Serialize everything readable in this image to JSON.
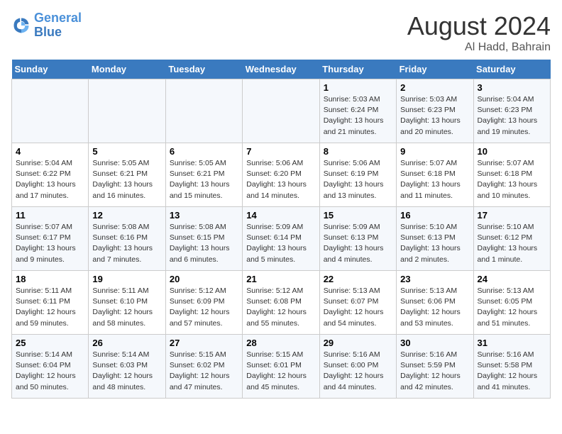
{
  "header": {
    "logo_line1": "General",
    "logo_line2": "Blue",
    "main_title": "August 2024",
    "subtitle": "Al Hadd, Bahrain"
  },
  "weekdays": [
    "Sunday",
    "Monday",
    "Tuesday",
    "Wednesday",
    "Thursday",
    "Friday",
    "Saturday"
  ],
  "weeks": [
    [
      {
        "day": "",
        "info": ""
      },
      {
        "day": "",
        "info": ""
      },
      {
        "day": "",
        "info": ""
      },
      {
        "day": "",
        "info": ""
      },
      {
        "day": "1",
        "info": "Sunrise: 5:03 AM\nSunset: 6:24 PM\nDaylight: 13 hours\nand 21 minutes."
      },
      {
        "day": "2",
        "info": "Sunrise: 5:03 AM\nSunset: 6:23 PM\nDaylight: 13 hours\nand 20 minutes."
      },
      {
        "day": "3",
        "info": "Sunrise: 5:04 AM\nSunset: 6:23 PM\nDaylight: 13 hours\nand 19 minutes."
      }
    ],
    [
      {
        "day": "4",
        "info": "Sunrise: 5:04 AM\nSunset: 6:22 PM\nDaylight: 13 hours\nand 17 minutes."
      },
      {
        "day": "5",
        "info": "Sunrise: 5:05 AM\nSunset: 6:21 PM\nDaylight: 13 hours\nand 16 minutes."
      },
      {
        "day": "6",
        "info": "Sunrise: 5:05 AM\nSunset: 6:21 PM\nDaylight: 13 hours\nand 15 minutes."
      },
      {
        "day": "7",
        "info": "Sunrise: 5:06 AM\nSunset: 6:20 PM\nDaylight: 13 hours\nand 14 minutes."
      },
      {
        "day": "8",
        "info": "Sunrise: 5:06 AM\nSunset: 6:19 PM\nDaylight: 13 hours\nand 13 minutes."
      },
      {
        "day": "9",
        "info": "Sunrise: 5:07 AM\nSunset: 6:18 PM\nDaylight: 13 hours\nand 11 minutes."
      },
      {
        "day": "10",
        "info": "Sunrise: 5:07 AM\nSunset: 6:18 PM\nDaylight: 13 hours\nand 10 minutes."
      }
    ],
    [
      {
        "day": "11",
        "info": "Sunrise: 5:07 AM\nSunset: 6:17 PM\nDaylight: 13 hours\nand 9 minutes."
      },
      {
        "day": "12",
        "info": "Sunrise: 5:08 AM\nSunset: 6:16 PM\nDaylight: 13 hours\nand 7 minutes."
      },
      {
        "day": "13",
        "info": "Sunrise: 5:08 AM\nSunset: 6:15 PM\nDaylight: 13 hours\nand 6 minutes."
      },
      {
        "day": "14",
        "info": "Sunrise: 5:09 AM\nSunset: 6:14 PM\nDaylight: 13 hours\nand 5 minutes."
      },
      {
        "day": "15",
        "info": "Sunrise: 5:09 AM\nSunset: 6:13 PM\nDaylight: 13 hours\nand 4 minutes."
      },
      {
        "day": "16",
        "info": "Sunrise: 5:10 AM\nSunset: 6:13 PM\nDaylight: 13 hours\nand 2 minutes."
      },
      {
        "day": "17",
        "info": "Sunrise: 5:10 AM\nSunset: 6:12 PM\nDaylight: 13 hours\nand 1 minute."
      }
    ],
    [
      {
        "day": "18",
        "info": "Sunrise: 5:11 AM\nSunset: 6:11 PM\nDaylight: 12 hours\nand 59 minutes."
      },
      {
        "day": "19",
        "info": "Sunrise: 5:11 AM\nSunset: 6:10 PM\nDaylight: 12 hours\nand 58 minutes."
      },
      {
        "day": "20",
        "info": "Sunrise: 5:12 AM\nSunset: 6:09 PM\nDaylight: 12 hours\nand 57 minutes."
      },
      {
        "day": "21",
        "info": "Sunrise: 5:12 AM\nSunset: 6:08 PM\nDaylight: 12 hours\nand 55 minutes."
      },
      {
        "day": "22",
        "info": "Sunrise: 5:13 AM\nSunset: 6:07 PM\nDaylight: 12 hours\nand 54 minutes."
      },
      {
        "day": "23",
        "info": "Sunrise: 5:13 AM\nSunset: 6:06 PM\nDaylight: 12 hours\nand 53 minutes."
      },
      {
        "day": "24",
        "info": "Sunrise: 5:13 AM\nSunset: 6:05 PM\nDaylight: 12 hours\nand 51 minutes."
      }
    ],
    [
      {
        "day": "25",
        "info": "Sunrise: 5:14 AM\nSunset: 6:04 PM\nDaylight: 12 hours\nand 50 minutes."
      },
      {
        "day": "26",
        "info": "Sunrise: 5:14 AM\nSunset: 6:03 PM\nDaylight: 12 hours\nand 48 minutes."
      },
      {
        "day": "27",
        "info": "Sunrise: 5:15 AM\nSunset: 6:02 PM\nDaylight: 12 hours\nand 47 minutes."
      },
      {
        "day": "28",
        "info": "Sunrise: 5:15 AM\nSunset: 6:01 PM\nDaylight: 12 hours\nand 45 minutes."
      },
      {
        "day": "29",
        "info": "Sunrise: 5:16 AM\nSunset: 6:00 PM\nDaylight: 12 hours\nand 44 minutes."
      },
      {
        "day": "30",
        "info": "Sunrise: 5:16 AM\nSunset: 5:59 PM\nDaylight: 12 hours\nand 42 minutes."
      },
      {
        "day": "31",
        "info": "Sunrise: 5:16 AM\nSunset: 5:58 PM\nDaylight: 12 hours\nand 41 minutes."
      }
    ]
  ]
}
